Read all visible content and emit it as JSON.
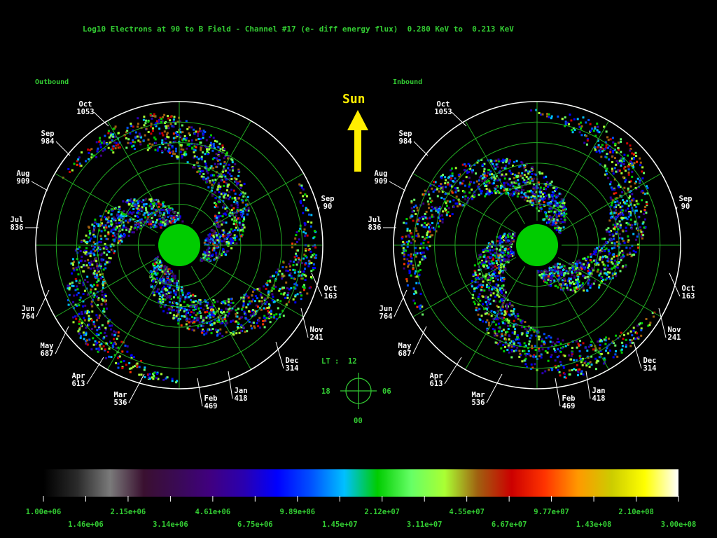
{
  "title": "Log10 Electrons at 90 to B Field - Channel #17 (e- diff energy flux)  0.280 KeV to  0.213 KeV",
  "sun_label": "Sun",
  "lt": {
    "label": "LT :  12",
    "top": "12",
    "bottom": "00",
    "left": "18",
    "right": "06"
  },
  "panels": [
    {
      "name": "Outbound",
      "month_labels": [
        {
          "month": "Oct",
          "day": "1053"
        },
        {
          "month": "Sep",
          "day": "984"
        },
        {
          "month": "Aug",
          "day": "909"
        },
        {
          "month": "Jul",
          "day": "836"
        },
        {
          "month": "Jun",
          "day": "764"
        },
        {
          "month": "May",
          "day": "687"
        },
        {
          "month": "Apr",
          "day": "613"
        },
        {
          "month": "Mar",
          "day": "536"
        },
        {
          "month": "Feb",
          "day": "469"
        },
        {
          "month": "Jan",
          "day": "418"
        },
        {
          "month": "Dec",
          "day": "314"
        },
        {
          "month": "Nov",
          "day": "241"
        },
        {
          "month": "Oct",
          "day": "163"
        },
        {
          "month": "Sep",
          "day": "90"
        }
      ]
    },
    {
      "name": "Inbound",
      "month_labels": [
        {
          "month": "Oct",
          "day": "1053"
        },
        {
          "month": "Sep",
          "day": "984"
        },
        {
          "month": "Aug",
          "day": "909"
        },
        {
          "month": "Jul",
          "day": "836"
        },
        {
          "month": "Jun",
          "day": "764"
        },
        {
          "month": "May",
          "day": "687"
        },
        {
          "month": "Apr",
          "day": "613"
        },
        {
          "month": "Mar",
          "day": "536"
        },
        {
          "month": "Feb",
          "day": "469"
        },
        {
          "month": "Jan",
          "day": "418"
        },
        {
          "month": "Dec",
          "day": "314"
        },
        {
          "month": "Nov",
          "day": "241"
        },
        {
          "month": "Oct",
          "day": "163"
        },
        {
          "month": "Sep",
          "day": "90"
        }
      ]
    }
  ],
  "colors": {
    "label_green": "#33cc33",
    "grid_green": "#22aa22",
    "planet": "#00cc00",
    "sun_arrow": "#ffee00"
  },
  "chart_data": {
    "type": "heatmap",
    "title": "Log10 Electrons at 90 to B Field - Channel #17 (e- diff energy flux)  0.280 KeV to  0.213 KeV",
    "projection": "polar",
    "panels": [
      "Outbound",
      "Inbound"
    ],
    "colorbar": {
      "range": [
        1000000.0,
        300000000.0
      ],
      "scale": "log",
      "tick_labels_upper": [
        "1.00e+06",
        "2.15e+06",
        "4.61e+06",
        "9.89e+06",
        "2.12e+07",
        "4.55e+07",
        "9.77e+07",
        "2.10e+08"
      ],
      "tick_labels_lower": [
        "1.46e+06",
        "3.14e+06",
        "6.75e+06",
        "1.45e+07",
        "3.11e+07",
        "6.67e+07",
        "1.43e+08",
        "3.00e+08"
      ],
      "colormap": [
        "#000000",
        "#2a2a2a",
        "#7a7a7a",
        "#3a1030",
        "#3a0a55",
        "#400080",
        "#2a00b0",
        "#0000ff",
        "#0050ff",
        "#00c0ff",
        "#00cc00",
        "#66ff66",
        "#aaff33",
        "#a06010",
        "#cc0000",
        "#ff3300",
        "#ff9900",
        "#cccc00",
        "#ffff00",
        "#ffffff"
      ]
    }
  }
}
